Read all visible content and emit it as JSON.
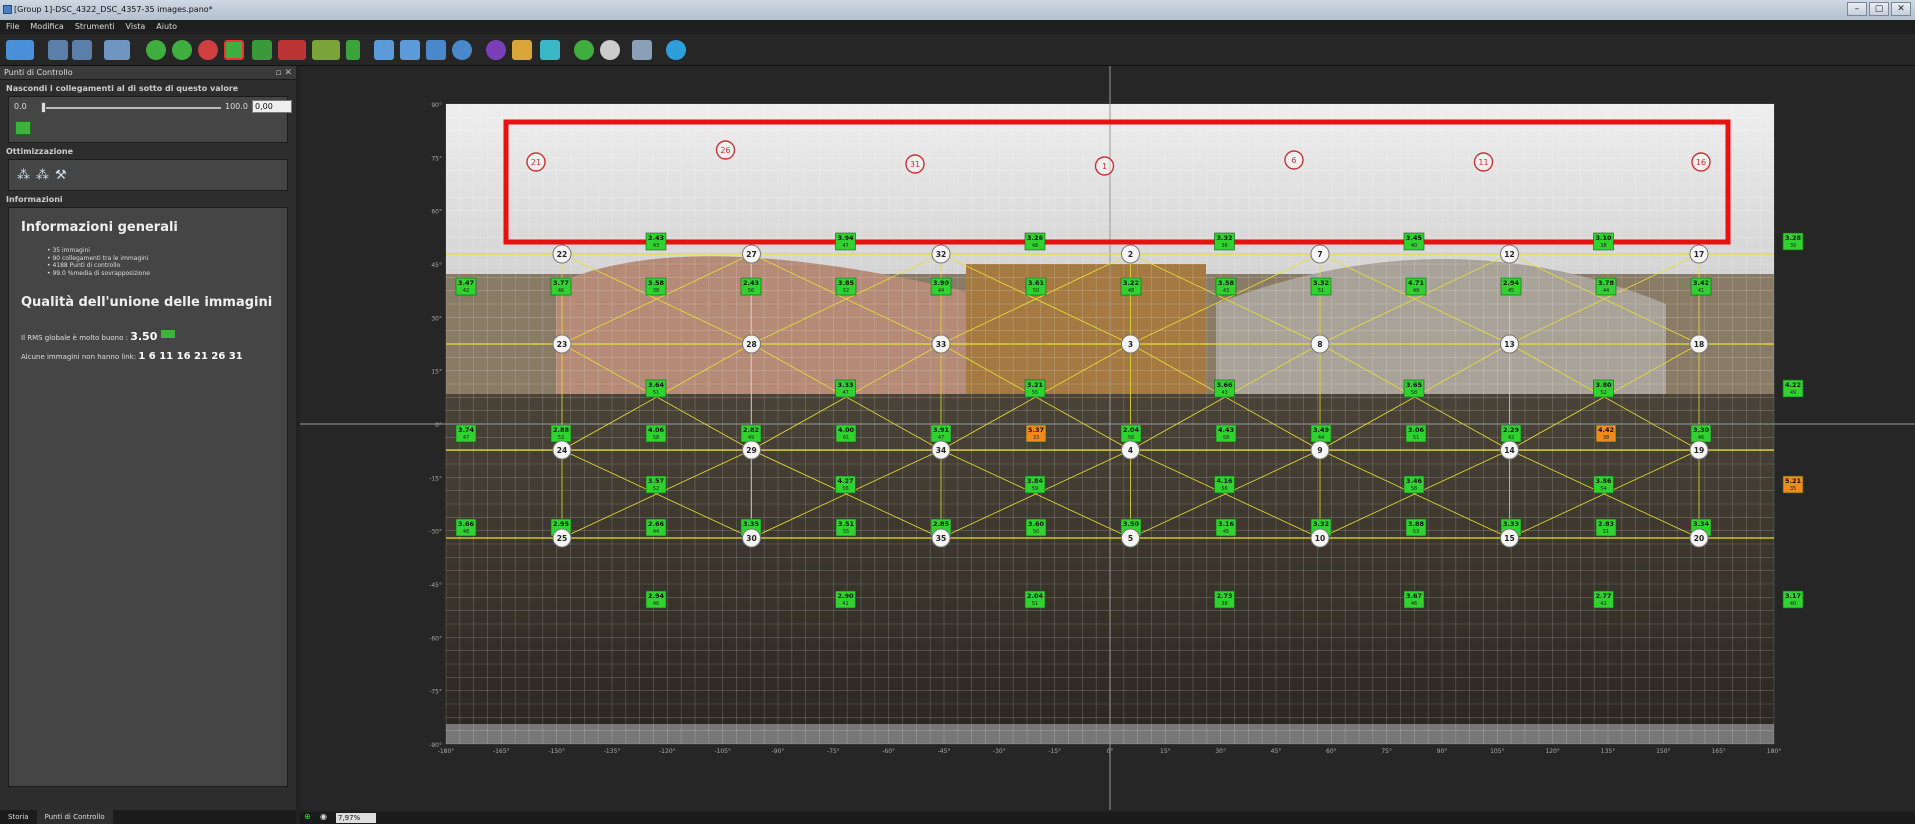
{
  "window": {
    "title": "[Group 1]-DSC_4322_DSC_4357-35 images.pano*",
    "controls": [
      "–",
      "▢",
      "✕"
    ]
  },
  "menu": [
    "File",
    "Modifica",
    "Strumenti",
    "Vista",
    "Aiuto"
  ],
  "panel": {
    "title": "Punti di Controllo",
    "hide_links_label": "Nascondi i collegamenti al di sotto di questo valore",
    "slider_min": "0.0",
    "slider_max": "100.0",
    "slider_value": "0,00",
    "optimization_label": "Ottimizzazione",
    "info_label": "Informazioni",
    "info_heading": "Informazioni generali",
    "info_items": [
      "35 immagini",
      "90 collegamenti tra le immagini",
      "4188 Punti di controllo",
      "99.0 %media di sovrapposizione"
    ],
    "quality_heading": "Qualità dell'unione delle immagini",
    "rms_text": "Il RMS globale è molto buono :",
    "rms_value": "3.50",
    "missing_text": "Alcune immagini non hanno link:",
    "missing_value": "1 6 11 16 21 26 31"
  },
  "bottom_tabs": [
    "Storia",
    "Punti di Controllo"
  ],
  "status": {
    "zoom": "7,97%"
  },
  "colors": {
    "green": "#2fd22f",
    "orange": "#f08a1c",
    "highlight": "#e81010",
    "grid_line": "#e8e030"
  },
  "viewport": {
    "y_ticks": [
      "90°",
      "75°",
      "60°",
      "45°",
      "30°",
      "15°",
      "0°",
      "-15°",
      "-30°",
      "-45°",
      "-60°",
      "-75°",
      "-90°"
    ],
    "x_ticks": [
      "-180°",
      "-165°",
      "-150°",
      "-135°",
      "-120°",
      "-105°",
      "-90°",
      "-75°",
      "-60°",
      "-45°",
      "-30°",
      "-15°",
      "0°",
      "15°",
      "30°",
      "45°",
      "60°",
      "75°",
      "90°",
      "105°",
      "120°",
      "135°",
      "150°",
      "165°",
      "180°"
    ],
    "unlinked": [
      "21",
      "26",
      "31",
      "1",
      "6",
      "11",
      "16"
    ],
    "nodes": [
      [
        "22",
        "27",
        "32",
        "2",
        "7",
        "12",
        "17"
      ],
      [
        "23",
        "28",
        "33",
        "3",
        "8",
        "13",
        "18"
      ],
      [
        "24",
        "29",
        "34",
        "4",
        "9",
        "14",
        "19"
      ],
      [
        "25",
        "30",
        "35",
        "5",
        "10",
        "15",
        "20"
      ]
    ],
    "links": [
      {
        "row": 0,
        "values": [
          "2.43",
          "3.94",
          "3.26",
          "3.32",
          "3.45",
          "3.10",
          "3.28"
        ],
        "sub": [
          "43",
          "47",
          "48",
          "36",
          "40",
          "38",
          "39"
        ],
        "orange": []
      },
      {
        "row": 1,
        "values": [
          "3.47",
          "3.77",
          "3.58",
          "2.43",
          "3.85",
          "3.90",
          "3.61",
          "3.22",
          "3.58",
          "3.32",
          "4.71",
          "2.94",
          "3.78",
          "3.42"
        ],
        "sub": [
          "42",
          "46",
          "38",
          "56",
          "52",
          "44",
          "50",
          "48",
          "43",
          "51",
          "49",
          "45",
          "44",
          "41"
        ],
        "orange": []
      },
      {
        "row": 2,
        "values": [
          "3.64",
          "3.33",
          "3.21",
          "3.66",
          "3.65",
          "3.80",
          "4.22"
        ],
        "sub": [
          "51",
          "47",
          "55",
          "43",
          "58",
          "52",
          "49"
        ],
        "orange": []
      },
      {
        "row": 3,
        "values": [
          "3.74",
          "2.88",
          "4.06",
          "2.82",
          "4.00",
          "3.91",
          "5.37",
          "2.04",
          "4.43",
          "3.49",
          "3.06",
          "2.29",
          "4.42",
          "3.30"
        ],
        "sub": [
          "47",
          "53",
          "58",
          "49",
          "61",
          "47",
          "33",
          "56",
          "58",
          "44",
          "51",
          "42",
          "38",
          "46"
        ],
        "orange": [
          6,
          12
        ]
      },
      {
        "row": 4,
        "values": [
          "3.57",
          "4.27",
          "3.84",
          "4.16",
          "3.46",
          "3.86",
          "5.21"
        ],
        "sub": [
          "52",
          "56",
          "59",
          "56",
          "58",
          "54",
          "35"
        ],
        "orange": [
          6
        ]
      },
      {
        "row": 5,
        "values": [
          "3.66",
          "2.95",
          "2.66",
          "3.35",
          "3.51",
          "2.85",
          "3.60",
          "3.50",
          "3.16",
          "3.32",
          "3.88",
          "3.33",
          "2.83",
          "3.34"
        ],
        "sub": [
          "48",
          "48",
          "44",
          "52",
          "55",
          "45",
          "50",
          "59",
          "45",
          "49",
          "53",
          "47",
          "51",
          "44"
        ],
        "orange": []
      },
      {
        "row": 6,
        "values": [
          "2.94",
          "2.90",
          "2.04",
          "2.73",
          "3.67",
          "2.77",
          "3.17"
        ],
        "sub": [
          "46",
          "41",
          "51",
          "38",
          "46",
          "42",
          "40"
        ],
        "orange": []
      }
    ]
  }
}
